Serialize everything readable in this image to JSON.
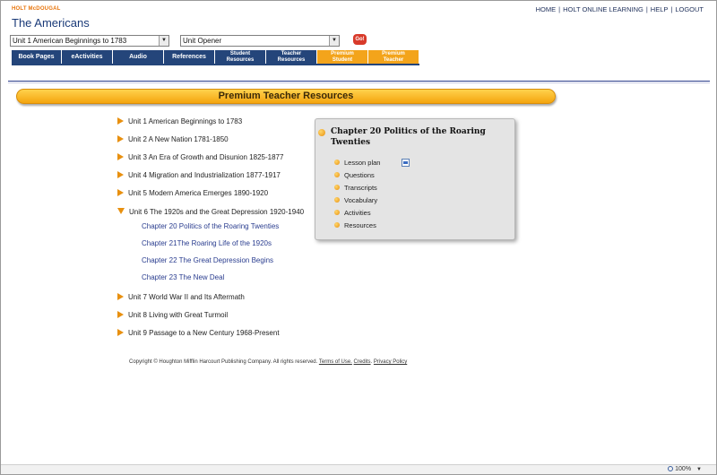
{
  "header": {
    "publisher": "HOLT McDOUGAL",
    "title": "The Americans",
    "links": [
      "HOME",
      "HOLT ONLINE LEARNING",
      "HELP",
      "LOGOUT"
    ]
  },
  "selectors": {
    "unit_select": "Unit 1 American Beginnings to 1783",
    "section_select": "Unit Opener",
    "go_label": "Go!"
  },
  "tabs": [
    {
      "label": "Book Pages"
    },
    {
      "label": "eActivities"
    },
    {
      "label": "Audio"
    },
    {
      "label": "References"
    },
    {
      "label_line1": "Student",
      "label_line2": "Resources"
    },
    {
      "label_line1": "Teacher",
      "label_line2": "Resources"
    },
    {
      "label_line1": "Premium",
      "label_line2": "Student"
    },
    {
      "label_line1": "Premium",
      "label_line2": "Teacher"
    }
  ],
  "banner": {
    "title": "Premium Teacher Resources"
  },
  "units": [
    "Unit 1 American Beginnings to 1783",
    "Unit 2 A New Nation 1781-1850",
    "Unit 3 An Era of Growth and Disunion 1825-1877",
    "Unit 4 Migration and Industrialization 1877-1917",
    "Unit 5 Modern America Emerges 1890-1920",
    "Unit 6 The 1920s and the Great Depression 1920-1940",
    "Unit 7 World War II and Its Aftermath",
    "Unit 8 Living with Great Turmoil",
    "Unit 9 Passage to a New Century 1968-Present"
  ],
  "chapters": [
    "Chapter 20 Politics of the Roaring Twenties",
    "Chapter 21The Roaring Life of the 1920s",
    "Chapter 22 The Great Depression Begins",
    "Chapter 23 The New Deal"
  ],
  "panel": {
    "title": "Chapter 20 Politics of the Roaring Twenties",
    "items": [
      "Lesson plan",
      "Questions",
      "Transcripts",
      "Vocabulary",
      "Activities",
      "Resources"
    ]
  },
  "footer": {
    "copyright": "Copyright © Houghton Mifflin Harcourt Publishing Company. All rights reserved.",
    "terms": "Terms of Use.",
    "credits": "Credits",
    "privacy": "Privacy Policy"
  },
  "status": {
    "zoom": "100%"
  },
  "colors": {
    "nav_tab": "#24457a",
    "premium_tab": "#f3a41b",
    "accent": "#e8900f",
    "chapter_link": "#2a3d8f"
  }
}
